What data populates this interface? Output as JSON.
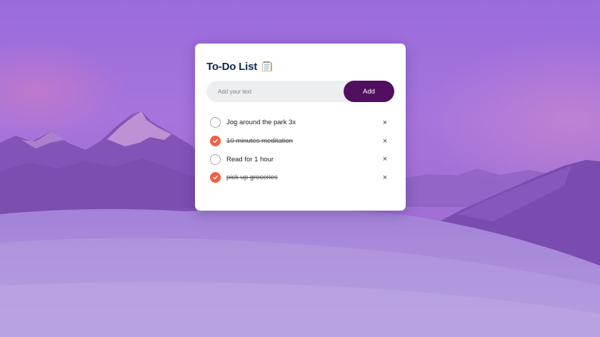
{
  "todo": {
    "title": "To-Do List",
    "title_icon": "notepad-icon",
    "input_placeholder": "Add your text",
    "input_value": "",
    "add_label": "Add",
    "delete_symbol": "×",
    "items": [
      {
        "text": "Jog around the park 3x",
        "done": false
      },
      {
        "text": "10 minutes meditation",
        "done": true
      },
      {
        "text": "Read for 1 hour",
        "done": false
      },
      {
        "text": "pick up groceries",
        "done": true
      }
    ]
  },
  "colors": {
    "overlay": "#9b6fd6",
    "title": "#0b2a4e",
    "add_button": "#520f60",
    "checked": "#f06045",
    "input_bg": "#edeef0"
  }
}
